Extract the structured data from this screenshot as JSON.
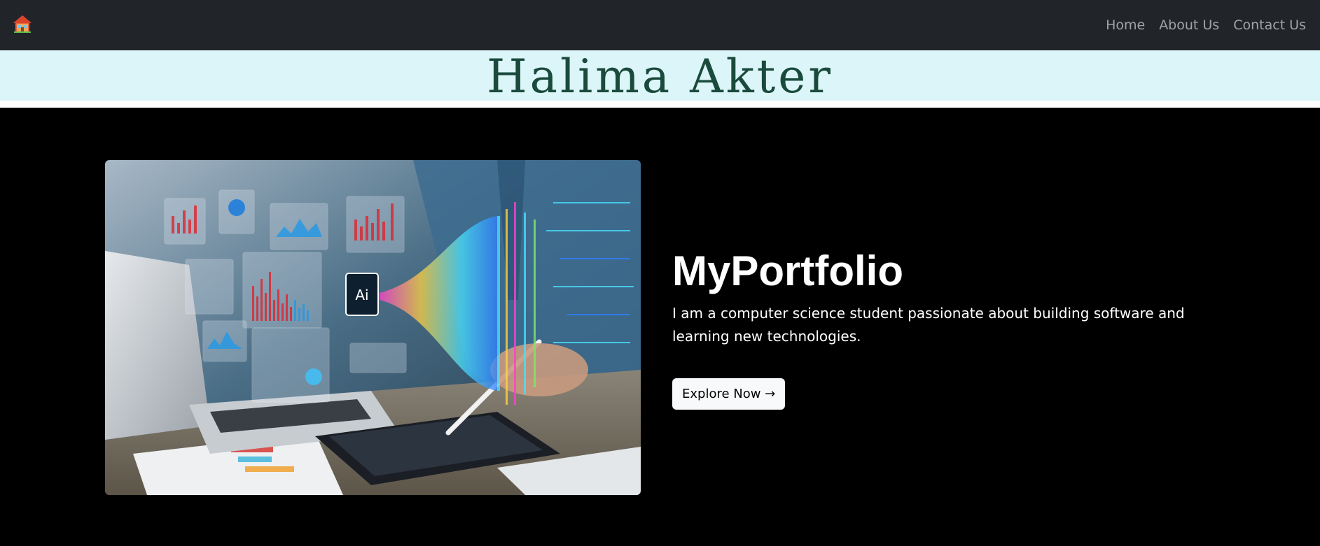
{
  "navbar": {
    "brand_icon": "house-icon",
    "links": [
      "Home",
      "About Us",
      "Contact Us"
    ]
  },
  "banner": {
    "title": "Halima Akter"
  },
  "hero": {
    "image_subject": "hero-image",
    "chip_label": "Ai",
    "title": "MyPortfolio",
    "description": "I am a computer science student passionate about building software and learning new technologies.",
    "button_label": "Explore Now →"
  },
  "colors": {
    "navbar_bg": "#212529",
    "banner_bg": "#dcf5f8",
    "title_color": "#1a4a3c",
    "hero_bg": "#000000",
    "button_bg": "#f8f9fa"
  }
}
